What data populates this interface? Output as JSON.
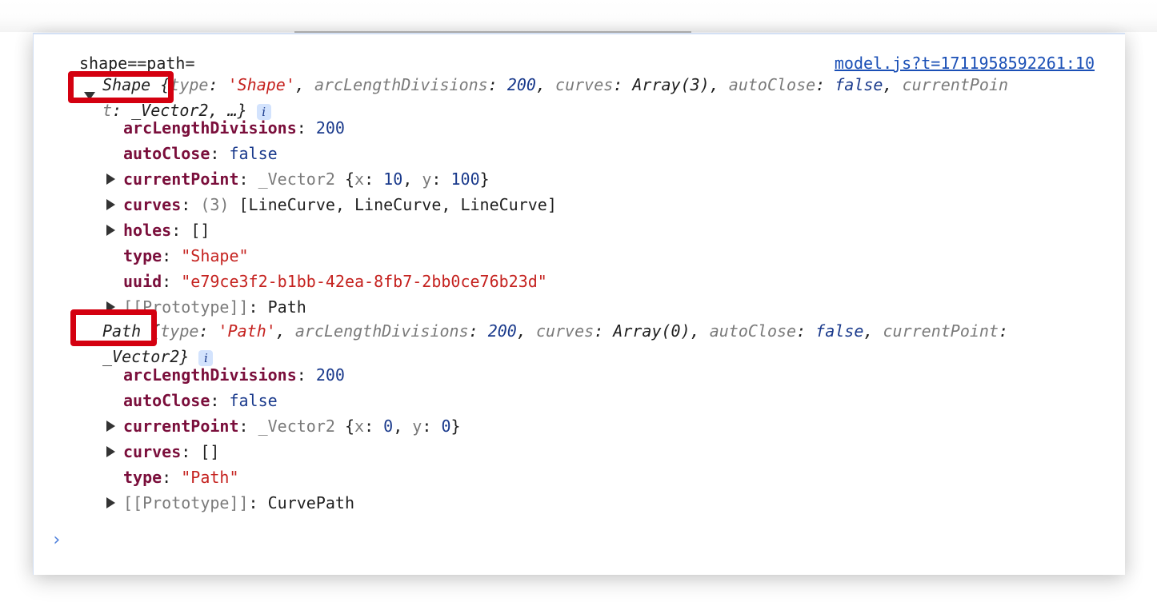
{
  "console": {
    "message_label": "shape==path=",
    "source_link": "model.js?t=1711958592261:10",
    "prompt_icon": "chevron-right-icon"
  },
  "shape_object": {
    "class_name": "Shape",
    "preview": {
      "open": "{",
      "type_key": "type",
      "type_val": "'Shape'",
      "arc_key": "arcLengthDivisions",
      "arc_val": "200",
      "curves_key": "curves",
      "curves_val": "Array(3)",
      "autoclose_key": "autoClose",
      "autoclose_val": "false",
      "current_key_part1": "currentPoin",
      "current_key_part2": "t",
      "current_val": "_Vector2",
      "ellipsis": "…}"
    },
    "properties": [
      {
        "key": "arcLengthDivisions",
        "value": "200"
      },
      {
        "key": "autoClose",
        "value": "false"
      },
      {
        "key": "currentPoint",
        "value_prefix": "_Vector2",
        "value": "{x: 10, y: 100}",
        "x": "10",
        "y": "100"
      },
      {
        "key": "curves",
        "count": "(3)",
        "value": "[LineCurve, LineCurve, LineCurve]"
      },
      {
        "key": "holes",
        "value": "[]"
      },
      {
        "key": "type",
        "value": "\"Shape\""
      },
      {
        "key": "uuid",
        "value": "\"e79ce3f2-b1bb-42ea-8fb7-2bb0ce76b23d\""
      },
      {
        "key": "[[Prototype]]",
        "value": "Path"
      }
    ]
  },
  "path_object": {
    "class_name": "Path",
    "preview": {
      "open": "{",
      "type_key": "type",
      "type_val": "'Path'",
      "arc_key": "arcLengthDivisions",
      "arc_val": "200",
      "curves_key": "curves",
      "curves_val": "Array(0)",
      "autoclose_key": "autoClose",
      "autoclose_val": "false",
      "current_key": "currentPoint",
      "current_val": "_Vector2}"
    },
    "properties": [
      {
        "key": "arcLengthDivisions",
        "value": "200"
      },
      {
        "key": "autoClose",
        "value": "false"
      },
      {
        "key": "currentPoint",
        "value_prefix": "_Vector2",
        "x": "0",
        "y": "0"
      },
      {
        "key": "curves",
        "value": "[]"
      },
      {
        "key": "type",
        "value": "\"Path\""
      },
      {
        "key": "[[Prototype]]",
        "value": "CurvePath"
      }
    ]
  },
  "annotation_colors": {
    "highlight_box": "#d40010"
  }
}
